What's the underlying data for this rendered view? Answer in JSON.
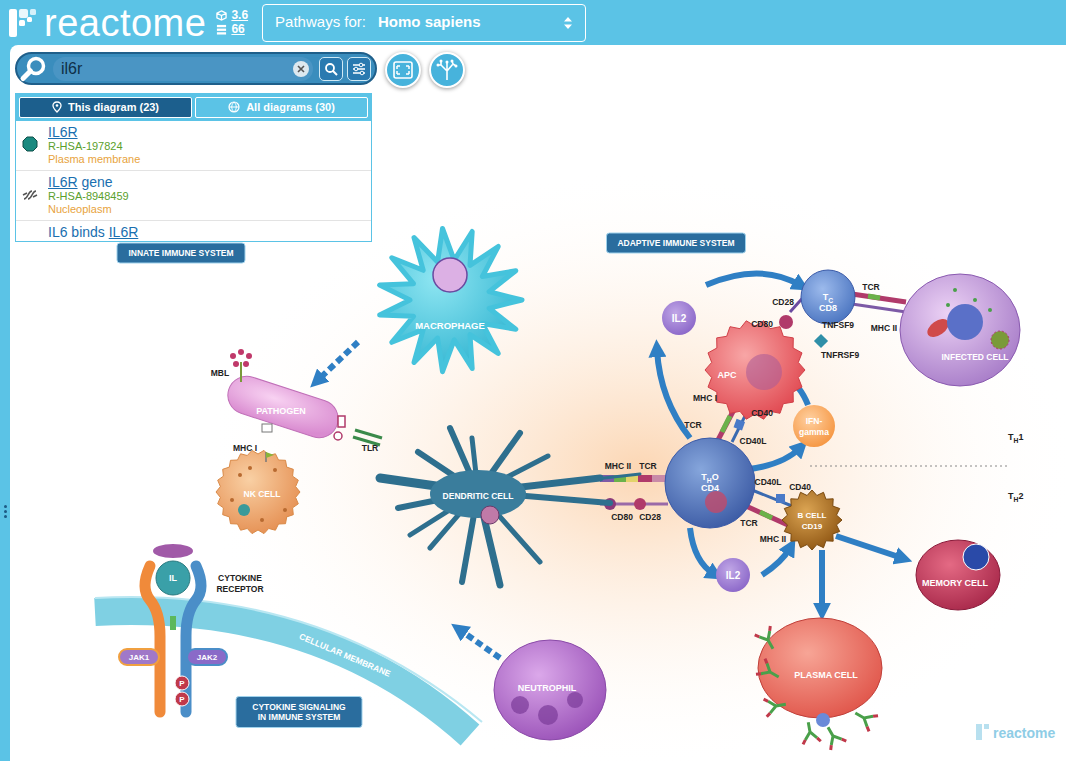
{
  "header": {
    "logo": "reactome",
    "version": "3.6",
    "diagrams": "66",
    "species_label": "Pathways for:",
    "species": "Homo sapiens"
  },
  "search": {
    "value": "il6r"
  },
  "results": {
    "tabs": [
      {
        "label": "This diagram (23)",
        "selected": true
      },
      {
        "label": "All diagrams (30)",
        "selected": false
      }
    ],
    "items": [
      {
        "name": [
          {
            "text": "IL6R",
            "match": true
          }
        ],
        "id": "R-HSA-197824",
        "compartment": "Plasma membrane",
        "kind": "protein"
      },
      {
        "name": [
          {
            "text": "IL6R",
            "match": true
          },
          {
            "text": " gene",
            "match": false
          }
        ],
        "id": "R-HSA-8948459",
        "compartment": "Nucleoplasm",
        "kind": "gene"
      },
      {
        "name": [
          {
            "text": "IL6 binds ",
            "match": false
          },
          {
            "text": "IL6R",
            "match": true
          }
        ],
        "kind": "reaction"
      }
    ]
  },
  "diagram": {
    "sections": [
      {
        "lines": [
          "INNATE IMMUNE SYSTEM"
        ]
      },
      {
        "lines": [
          "ADAPTIVE IMMUNE SYSTEM"
        ]
      },
      {
        "lines": [
          "CYTOKINE SIGNALING",
          "IN IMMUNE SYSTEM"
        ]
      }
    ],
    "cells": [
      {
        "lines": [
          "MACROPHAGE"
        ]
      },
      {
        "lines": [
          "PATHOGEN"
        ]
      },
      {
        "lines": [
          "NK CELL"
        ]
      },
      {
        "lines": [
          "DENDRITIC CELL"
        ]
      },
      {
        "lines": [
          "NEUTROPHIL"
        ]
      },
      {
        "lines": [
          "APC"
        ]
      },
      {
        "lines": [
          {
            "text": "T",
            "sub": "C"
          },
          "CD8"
        ]
      },
      {
        "lines": [
          "INFECTED CELL"
        ]
      },
      {
        "lines": [
          {
            "text": "T",
            "sub": "H",
            "after": "O"
          },
          "CD4"
        ]
      },
      {
        "lines": [
          "B CELL",
          "CD19"
        ]
      },
      {
        "lines": [
          "MEMORY CELL"
        ]
      },
      {
        "lines": [
          "PLASMA CELL"
        ]
      },
      {
        "lines": [
          "IL2"
        ]
      },
      {
        "lines": [
          "IL2"
        ]
      },
      {
        "lines": [
          "IFN-",
          "gamma"
        ]
      }
    ],
    "markers": [
      "MBL",
      "TLR",
      "MHC I",
      "MHC II",
      "TCR",
      "CD80",
      "CD28",
      "CD28",
      "CD80",
      "TNFSF9",
      "TNFRSF9",
      "TCR",
      "MHC II",
      "MHC I",
      "TCR",
      "CD40",
      "CD40L",
      "CD40L",
      "CD40",
      "TCR",
      "MHC II"
    ],
    "helpers": [
      {
        "text": "T",
        "sub": "H",
        "after": "1"
      },
      {
        "text": "T",
        "sub": "H",
        "after": "2"
      }
    ],
    "receptor": {
      "ligand": "IL",
      "label": [
        "CYTOKINE",
        "RECEPTOR"
      ],
      "kinases": [
        "JAK1",
        "JAK2"
      ],
      "phospho": [
        "P",
        "P"
      ]
    },
    "membrane": "CELLULAR MEMBRANE",
    "watermark": "reactome"
  }
}
